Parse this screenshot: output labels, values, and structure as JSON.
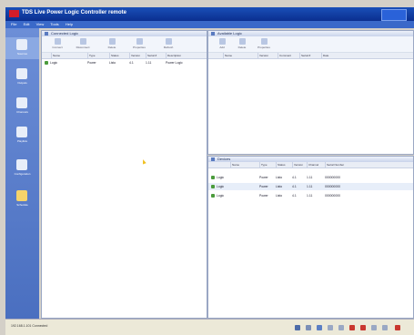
{
  "window": {
    "title": "TDS Live Power Logic Controller remote"
  },
  "menubar": {
    "items": [
      "File",
      "Edit",
      "View",
      "Tools",
      "Help"
    ]
  },
  "leftnav": {
    "items": [
      {
        "label": "Sources",
        "icon": "monitor-icon"
      },
      {
        "label": "Outputs",
        "icon": "speaker-icon"
      },
      {
        "label": "Channels",
        "icon": "person-icon"
      },
      {
        "label": "Playlists",
        "icon": "person-icon"
      },
      {
        "label": "Configuration",
        "icon": "music-note-icon"
      },
      {
        "label": "Schedule",
        "icon": "calendar-icon"
      }
    ]
  },
  "left_panel": {
    "title": "Connected Logic",
    "toolbar": [
      "Connect",
      "Disconnect",
      "Delete",
      "Properties",
      "Refresh"
    ],
    "columns": [
      "Name",
      "Type",
      "Status",
      "Version",
      "Serial #",
      "Description"
    ],
    "rows": [
      {
        "name": "Logic",
        "type": "Power",
        "status": "Listo",
        "version": "4.1",
        "serial": "1.11",
        "desc": "Power Logic"
      }
    ]
  },
  "right_top_panel": {
    "title": "Available Logic",
    "toolbar": [
      "Add",
      "Delete",
      "Properties"
    ],
    "columns": [
      "Name",
      "Version",
      "Comment",
      "Serial #",
      "Date"
    ]
  },
  "right_bottom_panel": {
    "title": "Devices",
    "columns": [
      "Name",
      "Type",
      "Status",
      "Version",
      "Channel",
      "Serial Number"
    ],
    "rows": [
      {
        "name": "Logic",
        "type": "Power",
        "status": "Listo",
        "version": "4.1",
        "channel": "1.11",
        "serial": "000000000"
      },
      {
        "name": "Logic",
        "type": "Power",
        "status": "Listo",
        "version": "4.1",
        "channel": "1.11",
        "serial": "000000000"
      },
      {
        "name": "Logic",
        "type": "Power",
        "status": "Listo",
        "version": "4.1",
        "channel": "1.11",
        "serial": "000000000"
      }
    ]
  },
  "statusbar": {
    "text": "192.168.1.101 Connected"
  }
}
